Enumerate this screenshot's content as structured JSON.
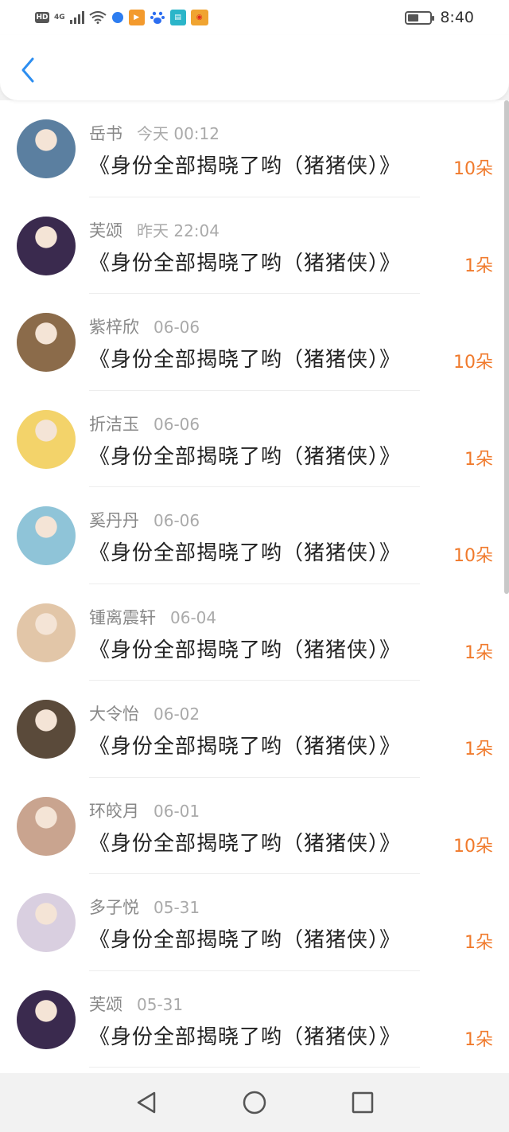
{
  "status_bar": {
    "network_label": "HD",
    "signal_label": "4G",
    "time": "8:40",
    "battery_percent": 50
  },
  "header": {
    "back_icon": "chevron-left-icon"
  },
  "colors": {
    "accent": "#2d8ef0",
    "amount": "#f07a2c"
  },
  "records": [
    {
      "name": "岳书",
      "time": "今天 00:12",
      "title": "《身份全部揭晓了哟（猪猪侠）》",
      "amount": "10朵",
      "avatar_color": "#5b7fa0"
    },
    {
      "name": "芙颂",
      "time": "昨天 22:04",
      "title": "《身份全部揭晓了哟（猪猪侠）》",
      "amount": "1朵",
      "avatar_color": "#3a2a4e"
    },
    {
      "name": "紫梓欣",
      "time": "06-06",
      "title": "《身份全部揭晓了哟（猪猪侠）》",
      "amount": "10朵",
      "avatar_color": "#8b6b4a"
    },
    {
      "name": "折洁玉",
      "time": "06-06",
      "title": "《身份全部揭晓了哟（猪猪侠）》",
      "amount": "1朵",
      "avatar_color": "#f3d36a"
    },
    {
      "name": "奚丹丹",
      "time": "06-06",
      "title": "《身份全部揭晓了哟（猪猪侠）》",
      "amount": "10朵",
      "avatar_color": "#8fc4d8"
    },
    {
      "name": "锺离震轩",
      "time": "06-04",
      "title": "《身份全部揭晓了哟（猪猪侠）》",
      "amount": "1朵",
      "avatar_color": "#e2c6a8"
    },
    {
      "name": "大令怡",
      "time": "06-02",
      "title": "《身份全部揭晓了哟（猪猪侠）》",
      "amount": "1朵",
      "avatar_color": "#5a4a3a"
    },
    {
      "name": "环皎月",
      "time": "06-01",
      "title": "《身份全部揭晓了哟（猪猪侠）》",
      "amount": "10朵",
      "avatar_color": "#c9a48f"
    },
    {
      "name": "多子悦",
      "time": "05-31",
      "title": "《身份全部揭晓了哟（猪猪侠）》",
      "amount": "1朵",
      "avatar_color": "#d9cfe0"
    },
    {
      "name": "芙颂",
      "time": "05-31",
      "title": "《身份全部揭晓了哟（猪猪侠）》",
      "amount": "1朵",
      "avatar_color": "#3a2a4e"
    }
  ],
  "nav_bar": {
    "back_icon": "triangle-back-icon",
    "home_icon": "circle-home-icon",
    "recents_icon": "square-recents-icon"
  }
}
